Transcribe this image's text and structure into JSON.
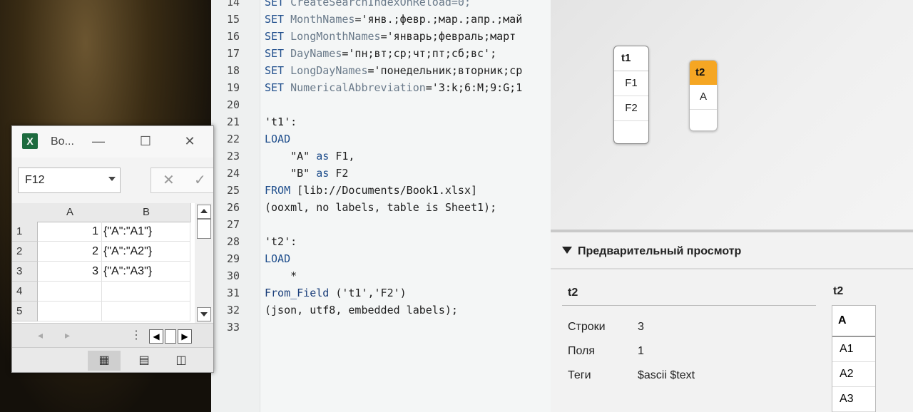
{
  "editor": {
    "lines": [
      {
        "n": "14",
        "parts": [
          {
            "c": "kw",
            "t": "SET "
          },
          {
            "c": "id",
            "t": "CreateSearchIndexOnReload=0;"
          }
        ]
      },
      {
        "n": "15",
        "parts": [
          {
            "c": "kw",
            "t": "SET "
          },
          {
            "c": "id",
            "t": "MonthNames"
          },
          {
            "c": "",
            "t": "='янв.;февр.;мар.;апр.;май"
          }
        ]
      },
      {
        "n": "16",
        "parts": [
          {
            "c": "kw",
            "t": "SET "
          },
          {
            "c": "id",
            "t": "LongMonthNames"
          },
          {
            "c": "",
            "t": "='январь;февраль;март"
          }
        ]
      },
      {
        "n": "17",
        "parts": [
          {
            "c": "kw",
            "t": "SET "
          },
          {
            "c": "id",
            "t": "DayNames"
          },
          {
            "c": "",
            "t": "='пн;вт;ср;чт;пт;сб;вс';"
          }
        ]
      },
      {
        "n": "18",
        "parts": [
          {
            "c": "kw",
            "t": "SET "
          },
          {
            "c": "id",
            "t": "LongDayNames"
          },
          {
            "c": "",
            "t": "='понедельник;вторник;ср"
          }
        ]
      },
      {
        "n": "19",
        "parts": [
          {
            "c": "kw",
            "t": "SET "
          },
          {
            "c": "id",
            "t": "NumericalAbbreviation"
          },
          {
            "c": "",
            "t": "='3:k;6:M;9:G;1"
          }
        ]
      },
      {
        "n": "20",
        "parts": []
      },
      {
        "n": "21",
        "parts": [
          {
            "c": "",
            "t": "'t1':"
          }
        ]
      },
      {
        "n": "22",
        "parts": [
          {
            "c": "kw",
            "t": "LOAD"
          }
        ]
      },
      {
        "n": "23",
        "parts": [
          {
            "c": "",
            "t": "    \"A\" "
          },
          {
            "c": "kw",
            "t": "as"
          },
          {
            "c": "",
            "t": " F1,"
          }
        ]
      },
      {
        "n": "24",
        "parts": [
          {
            "c": "",
            "t": "    \"B\" "
          },
          {
            "c": "kw",
            "t": "as"
          },
          {
            "c": "",
            "t": " F2"
          }
        ]
      },
      {
        "n": "25",
        "parts": [
          {
            "c": "kw",
            "t": "FROM"
          },
          {
            "c": "",
            "t": " [lib://Documents/Book1.xlsx]"
          }
        ]
      },
      {
        "n": "26",
        "parts": [
          {
            "c": "",
            "t": "(ooxml, no labels, table is Sheet1);"
          }
        ]
      },
      {
        "n": "27",
        "parts": []
      },
      {
        "n": "28",
        "parts": [
          {
            "c": "",
            "t": "'t2':"
          }
        ]
      },
      {
        "n": "29",
        "parts": [
          {
            "c": "kw",
            "t": "LOAD"
          }
        ]
      },
      {
        "n": "30",
        "parts": [
          {
            "c": "",
            "t": "    *"
          }
        ]
      },
      {
        "n": "31",
        "parts": [
          {
            "c": "bl",
            "t": "From_Field"
          },
          {
            "c": "",
            "t": " ('t1','F2')"
          }
        ]
      },
      {
        "n": "32",
        "parts": [
          {
            "c": "",
            "t": "(json, utf8, embedded labels);"
          }
        ]
      },
      {
        "n": "33",
        "parts": []
      }
    ]
  },
  "model": {
    "tables": [
      {
        "name": "t1",
        "fields": [
          "F1",
          "F2"
        ],
        "highlight": false
      },
      {
        "name": "t2",
        "fields": [
          "A"
        ],
        "highlight": true
      }
    ],
    "highlight_color": "#f5a623"
  },
  "preview": {
    "heading": "Предварительный просмотр",
    "table_name": "t2",
    "meta": [
      {
        "label": "Строки",
        "value": "3"
      },
      {
        "label": "Поля",
        "value": "1"
      },
      {
        "label": "Теги",
        "value": "$ascii $text"
      }
    ],
    "data_table": {
      "title": "t2",
      "column": "A",
      "rows": [
        "A1",
        "A2",
        "A3"
      ]
    }
  },
  "excel": {
    "title": "Bo...",
    "logo": "X",
    "name_box": "F12",
    "columns": [
      "A",
      "B"
    ],
    "rows": [
      {
        "n": "1",
        "a": "1",
        "b": "{\"A\":\"A1\"}"
      },
      {
        "n": "2",
        "a": "2",
        "b": "{\"A\":\"A2\"}"
      },
      {
        "n": "3",
        "a": "3",
        "b": "{\"A\":\"A3\"}"
      },
      {
        "n": "4",
        "a": "",
        "b": ""
      },
      {
        "n": "5",
        "a": "",
        "b": ""
      }
    ],
    "minimize": "—",
    "maximize": "☐",
    "close": "✕",
    "fx_cancel": "✕",
    "fx_enter": "✓"
  }
}
